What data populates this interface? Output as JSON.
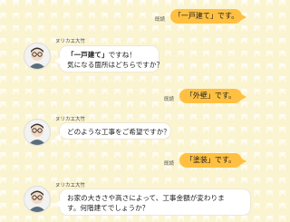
{
  "messages": {
    "m1": {
      "read": "既読",
      "text": "「一戸建て」です。"
    },
    "m2": {
      "agent": "ヌリカエ大竹",
      "text_a": "「一戸建て」",
      "text_b": "ですね！",
      "text_c": "気になる箇所はどちらですか？"
    },
    "m3": {
      "read": "既読",
      "text": "「外壁」です。"
    },
    "m4": {
      "agent": "ヌリカエ大竹",
      "text": "どのような工事をご希望ですか？"
    },
    "m5": {
      "read": "既読",
      "text": "「塗装」です。"
    },
    "m6": {
      "agent": "ヌリカエ大竹",
      "line1": "お家の大きさや高さによって、工事金額が変わりま",
      "line2": "す。何階建てでしょうか？"
    }
  },
  "colors": {
    "user_bubble": "#ffc042",
    "agent_bubble": "#ffffff",
    "background": "#fbf4d0"
  },
  "icons": {
    "avatar": "person-with-glasses-avatar-icon"
  }
}
